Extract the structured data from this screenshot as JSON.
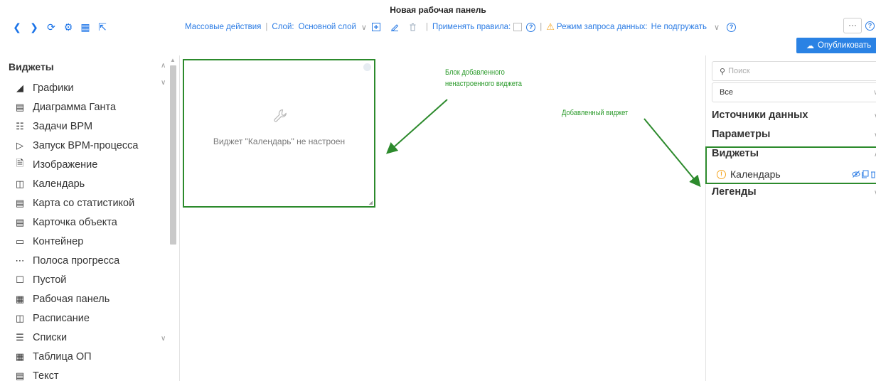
{
  "title": "Новая рабочая панель",
  "nav_icons": [
    "back-icon",
    "forward-icon",
    "refresh-icon",
    "settings-icon",
    "dashboard-icon",
    "fullscreen-icon"
  ],
  "toolbar": {
    "bulk_actions": "Массовые действия",
    "layer_label": "Слой:",
    "layer_value": "Основной слой",
    "apply_rules_label": "Применять правила:",
    "data_mode_label": "Режим запроса данных:",
    "data_mode_value": "Не подгружать"
  },
  "more_label": "···",
  "publish_label": "Опубликовать",
  "sidebar": {
    "title": "Виджеты",
    "items": [
      {
        "label": "Графики",
        "icon": "chart-icon"
      },
      {
        "label": "Диаграмма Ганта",
        "icon": "gantt-icon"
      },
      {
        "label": "Задачи BPM",
        "icon": "bpm-tasks-icon"
      },
      {
        "label": "Запуск BPM-процесса",
        "icon": "bpm-start-icon"
      },
      {
        "label": "Изображение",
        "icon": "image-file-icon"
      },
      {
        "label": "Календарь",
        "icon": "calendar-icon"
      },
      {
        "label": "Карта со статистикой",
        "icon": "map-icon"
      },
      {
        "label": "Карточка объекта",
        "icon": "object-card-icon"
      },
      {
        "label": "Контейнер",
        "icon": "folder-icon"
      },
      {
        "label": "Полоса прогресса",
        "icon": "progress-icon"
      },
      {
        "label": "Пустой",
        "icon": "empty-icon"
      },
      {
        "label": "Рабочая панель",
        "icon": "panel-icon"
      },
      {
        "label": "Расписание",
        "icon": "schedule-icon"
      },
      {
        "label": "Списки",
        "icon": "list-icon"
      },
      {
        "label": "Таблица ОП",
        "icon": "table-icon"
      },
      {
        "label": "Текст",
        "icon": "text-icon"
      }
    ]
  },
  "canvas": {
    "widget_message": "Виджет \"Календарь\" не настроен",
    "annotation_block_line1": "Блок добавленного",
    "annotation_block_line2": "ненастроенного виджета",
    "annotation_added": "Добавленный виджет"
  },
  "right_panel": {
    "search_placeholder": "Поиск",
    "filter_value": "Все",
    "sections": {
      "sources": "Источники данных",
      "params": "Параметры",
      "widgets": "Виджеты",
      "legends": "Легенды"
    },
    "widget_item": "Календарь"
  },
  "colors": {
    "accent": "#2a7be4",
    "annotation": "#2c8a2c",
    "warning": "#f5a623",
    "publish": "#2a82e4"
  }
}
